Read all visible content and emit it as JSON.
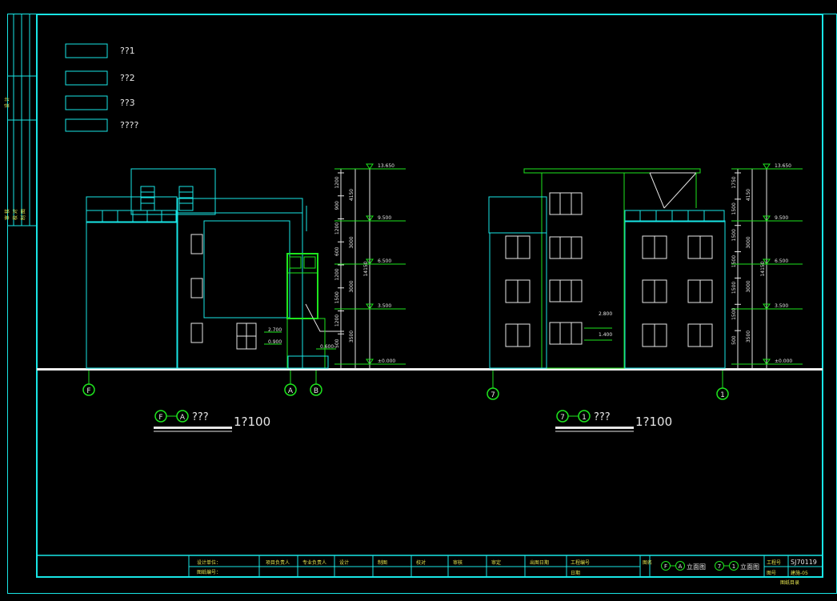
{
  "legend": [
    {
      "label": "??1",
      "pattern": "brick-gray"
    },
    {
      "label": "??2",
      "pattern": "brick-orange"
    },
    {
      "label": "??3",
      "pattern": "wood-gray"
    },
    {
      "label": "????",
      "pattern": "stone-speckle"
    }
  ],
  "left_view": {
    "title": "???",
    "scale": "1?100",
    "from_axis": "F",
    "to_axis": "A",
    "axis_labels": [
      "F",
      "A",
      "B"
    ],
    "level_marks": [
      "13.650",
      "9.500",
      "6.500",
      "3.500",
      "±0.000"
    ],
    "inner_marks": [
      "2.700",
      "0.900",
      "0.600"
    ],
    "dim_labels": [
      "4150",
      "3000",
      "3000",
      "3500",
      "14150",
      "1200",
      "900",
      "1200",
      "600",
      "1200",
      "1500",
      "1200",
      "500"
    ]
  },
  "right_view": {
    "title": "???",
    "scale": "1?100",
    "from_axis": "7",
    "to_axis": "1",
    "axis_labels": [
      "7",
      "1"
    ],
    "level_marks": [
      "13.650",
      "9.500",
      "6.500",
      "3.500",
      "±0.000"
    ],
    "inner_marks": [
      "2.800",
      "1.400"
    ],
    "dim_labels": [
      "4150",
      "3000",
      "3000",
      "3500",
      "14150",
      "1750",
      "1500",
      "1500",
      "1500",
      "1500",
      "1500",
      "500"
    ]
  },
  "side_strip": [
    "设",
    "计",
    "审",
    "核",
    "校",
    "对",
    "制",
    "图"
  ],
  "title_block": {
    "cells": [
      "设计单位：",
      "项目负责人",
      "专业负责人",
      "设计",
      "制图",
      "校对",
      "审核",
      "审定",
      "出图日期",
      "工程编号",
      "日期"
    ],
    "row2": "图纸编号：",
    "sheet_label": "图名",
    "sheet_names": [
      "F",
      "A",
      "立面图",
      "7",
      "1",
      "立面图"
    ],
    "project_no_label": "工程号",
    "project_no": "SJ70119",
    "drawing_no_label": "图号",
    "drawing_no": "建施-05",
    "bottom_note": "图纸目录"
  }
}
